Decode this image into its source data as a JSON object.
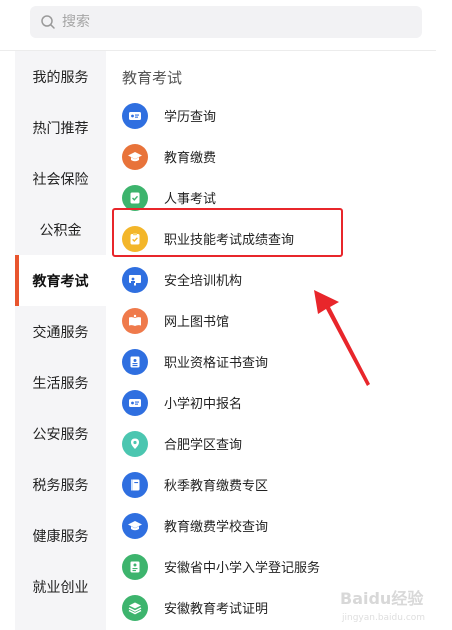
{
  "search": {
    "placeholder": "搜索"
  },
  "sidebar": {
    "items": [
      {
        "label": "我的服务",
        "active": false
      },
      {
        "label": "热门推荐",
        "active": false
      },
      {
        "label": "社会保险",
        "active": false
      },
      {
        "label": "公积金",
        "active": false
      },
      {
        "label": "教育考试",
        "active": true
      },
      {
        "label": "交通服务",
        "active": false
      },
      {
        "label": "生活服务",
        "active": false
      },
      {
        "label": "公安服务",
        "active": false
      },
      {
        "label": "税务服务",
        "active": false
      },
      {
        "label": "健康服务",
        "active": false
      },
      {
        "label": "就业创业",
        "active": false
      }
    ]
  },
  "content": {
    "section_title": "教育考试",
    "items": [
      {
        "label": "学历查询",
        "icon": "id-card-icon",
        "color": "#2f6fe0"
      },
      {
        "label": "教育缴费",
        "icon": "graduation-cap-icon",
        "color": "#e8733a"
      },
      {
        "label": "人事考试",
        "icon": "checklist-icon",
        "color": "#3db46d"
      },
      {
        "label": "职业技能考试成绩查询",
        "icon": "clipboard-check-icon",
        "color": "#f3b62a"
      },
      {
        "label": "安全培训机构",
        "icon": "presentation-icon",
        "color": "#2f6fe0"
      },
      {
        "label": "网上图书馆",
        "icon": "open-book-icon",
        "color": "#ef7a4b"
      },
      {
        "label": "职业资格证书查询",
        "icon": "certificate-icon",
        "color": "#2f6fe0"
      },
      {
        "label": "小学初中报名",
        "icon": "id-card-icon",
        "color": "#2f6fe0"
      },
      {
        "label": "合肥学区查询",
        "icon": "location-pin-icon",
        "color": "#4bc6b0"
      },
      {
        "label": "秋季教育缴费专区",
        "icon": "book-icon",
        "color": "#2f6fe0"
      },
      {
        "label": "教育缴费学校查询",
        "icon": "graduation-cap-icon",
        "color": "#2f6fe0"
      },
      {
        "label": "安徽省中小学入学登记服务",
        "icon": "document-icon",
        "color": "#3db46d"
      },
      {
        "label": "安徽教育考试证明",
        "icon": "stack-icon",
        "color": "#3db46d"
      }
    ]
  },
  "annotation": {
    "highlight_color": "#e8262b",
    "arrow_color": "#e8262b"
  },
  "watermark": {
    "text": "Baidu经验",
    "sub": "jingyan.baidu.com"
  }
}
